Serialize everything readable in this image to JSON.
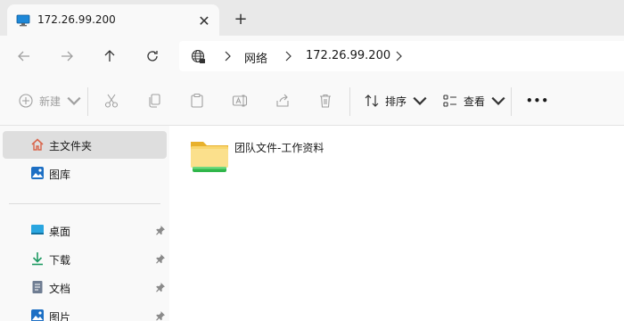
{
  "tab": {
    "title": "172.26.99.200",
    "close": "✕",
    "new_tab": "+"
  },
  "breadcrumb": {
    "items": [
      "网络",
      "172.26.99.200"
    ]
  },
  "toolbar": {
    "new_label": "新建",
    "sort_label": "排序",
    "view_label": "查看",
    "more": "•••"
  },
  "sidebar": {
    "items": [
      {
        "label": "主文件夹",
        "icon": "home-icon"
      },
      {
        "label": "图库",
        "icon": "gallery-icon"
      },
      {
        "label": "桌面",
        "icon": "desktop-icon"
      },
      {
        "label": "下载",
        "icon": "download-icon"
      },
      {
        "label": "文档",
        "icon": "document-icon"
      },
      {
        "label": "图片",
        "icon": "pictures-icon"
      }
    ]
  },
  "files": [
    {
      "name": "团队文件-工作资料",
      "icon": "network-folder-icon"
    }
  ],
  "colors": {
    "accent": "#0067c0",
    "folder": "#f9c941",
    "network": "#2fb64a"
  }
}
